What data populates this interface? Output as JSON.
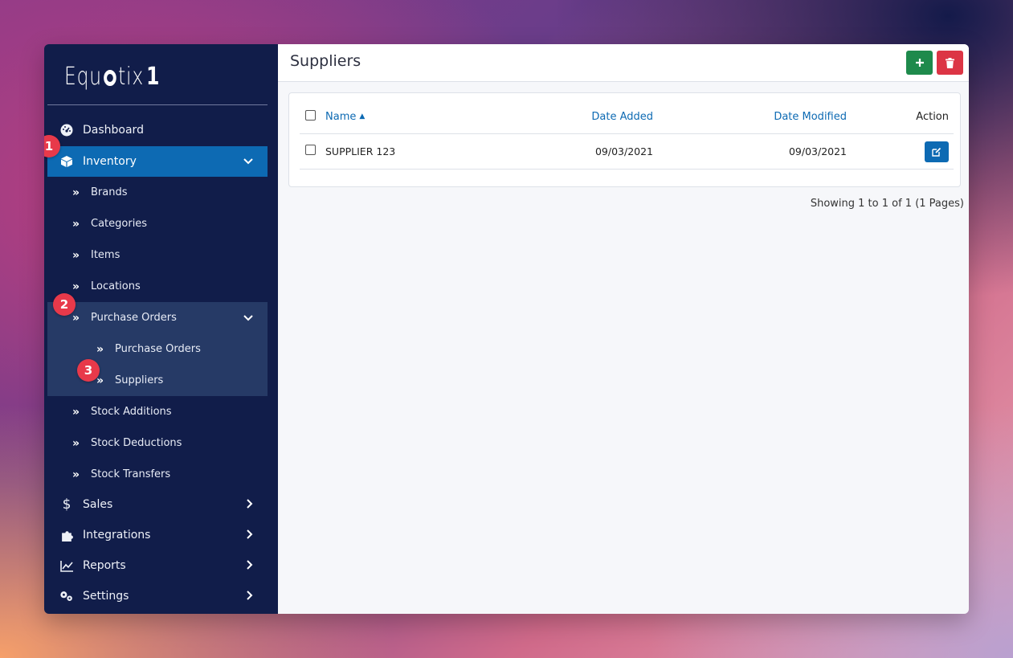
{
  "app": {
    "logo_text_1": "Equ",
    "logo_text_2": "tix",
    "logo_text_3": "1"
  },
  "sidebar": {
    "dashboard": "Dashboard",
    "inventory": "Inventory",
    "brands": "Brands",
    "categories": "Categories",
    "items": "Items",
    "locations": "Locations",
    "purchase_orders_group": "Purchase Orders",
    "purchase_orders": "Purchase Orders",
    "suppliers": "Suppliers",
    "stock_additions": "Stock Additions",
    "stock_deductions": "Stock Deductions",
    "stock_transfers": "Stock Transfers",
    "sales": "Sales",
    "integrations": "Integrations",
    "reports": "Reports",
    "settings": "Settings"
  },
  "badges": {
    "one": "1",
    "two": "2",
    "three": "3"
  },
  "colors": {
    "sidebar_bg": "#111d4a",
    "active": "#0d6ab3",
    "add": "#1e8a4c",
    "delete": "#dc3545",
    "badge": "#e8394a"
  },
  "header": {
    "title": "Suppliers",
    "add_icon": "plus-icon",
    "delete_icon": "trash-icon"
  },
  "table": {
    "columns": {
      "name": "Name",
      "date_added": "Date Added",
      "date_modified": "Date Modified",
      "action": "Action"
    },
    "rows": [
      {
        "name": "SUPPLIER 123",
        "date_added": "09/03/2021",
        "date_modified": "09/03/2021"
      }
    ]
  },
  "pager": {
    "info": "Showing 1 to 1 of 1 (1 Pages)"
  }
}
